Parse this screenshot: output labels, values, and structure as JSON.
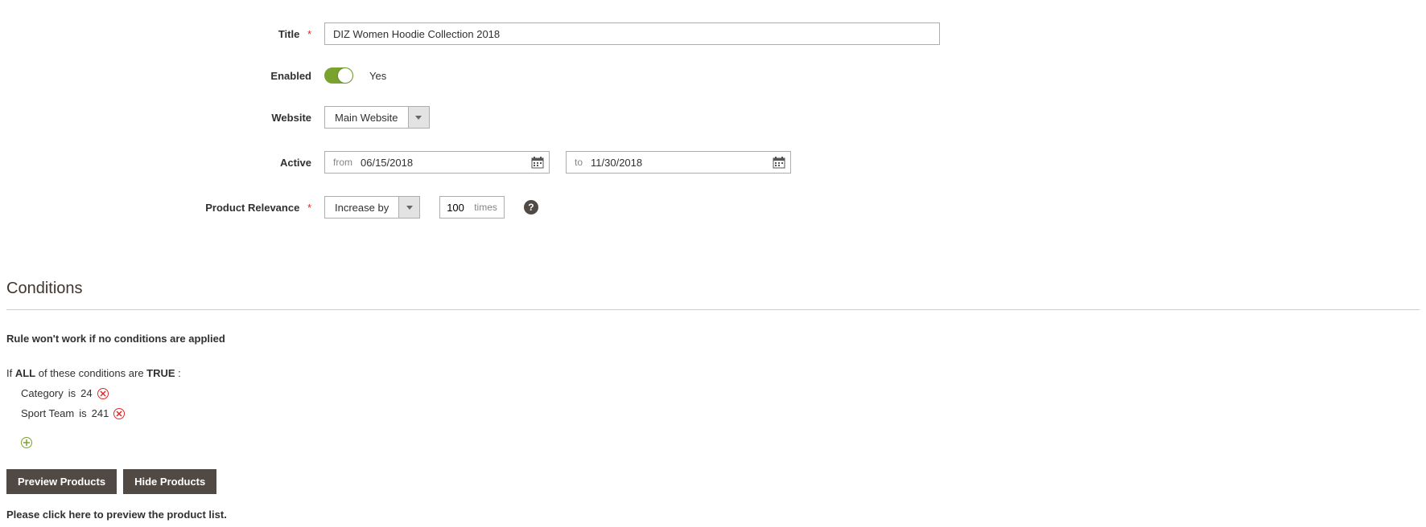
{
  "form": {
    "title": {
      "label": "Title",
      "value": "DIZ Women Hoodie Collection 2018"
    },
    "enabled": {
      "label": "Enabled",
      "state_text": "Yes"
    },
    "website": {
      "label": "Website",
      "selected": "Main Website"
    },
    "active": {
      "label": "Active",
      "from_prefix": "from",
      "from_value": "06/15/2018",
      "to_prefix": "to",
      "to_value": "11/30/2018"
    },
    "relevance": {
      "label": "Product Relevance",
      "action": "Increase by",
      "value": "100",
      "suffix": "times"
    }
  },
  "conditions": {
    "heading": "Conditions",
    "note": "Rule won't work if no conditions are applied",
    "prefix_if": "If ",
    "aggregator": "ALL",
    "mid_text": "  of these conditions are ",
    "result": "TRUE",
    "suffix": " :",
    "items": [
      {
        "attribute": "Category",
        "operator": "is",
        "value": "24"
      },
      {
        "attribute": "Sport Team",
        "operator": "is",
        "value": "241"
      }
    ]
  },
  "buttons": {
    "preview": "Preview Products",
    "hide": "Hide Products"
  },
  "footer_note": "Please click here to preview the product list."
}
